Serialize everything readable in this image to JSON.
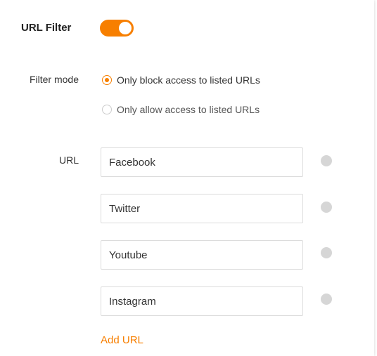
{
  "url_filter": {
    "title": "URL Filter",
    "enabled": true,
    "accent_color": "#f77f00"
  },
  "filter_mode": {
    "label": "Filter mode",
    "options": [
      {
        "label": "Only block access to listed URLs",
        "selected": true
      },
      {
        "label": "Only allow access to listed URLs",
        "selected": false
      }
    ]
  },
  "url_list": {
    "label": "URL",
    "entries": [
      "Facebook",
      "Twitter",
      "Youtube",
      "Instagram"
    ],
    "add_label": "Add URL",
    "remove_icon": "remove-circle-icon"
  }
}
